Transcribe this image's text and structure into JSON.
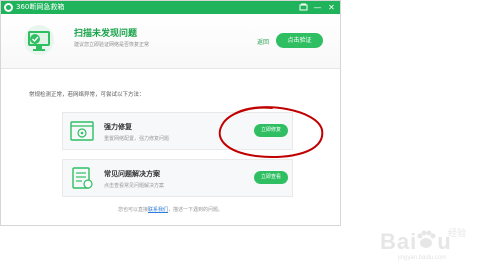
{
  "window": {
    "title": "360断网急救箱",
    "controls": {
      "skin": "skin-icon",
      "minimize": "—",
      "close": "✕"
    }
  },
  "header": {
    "title": "扫描未发现问题",
    "subtitle": "建议您立即验证网络是否恢复正常",
    "return_link": "返回",
    "verify_button": "点击验证"
  },
  "hint": "常规检测正常，若网络异常，可尝试以下方法：",
  "cards": [
    {
      "title": "强力修复",
      "desc": "重置网络配置，强力修复问题",
      "button": "立即修复",
      "icon": "browser-repair-icon"
    },
    {
      "title": "常见问题解决方案",
      "desc": "点击查看常见问题解决方案",
      "button": "立即查看",
      "icon": "document-list-icon"
    }
  ],
  "footer": {
    "prefix": "您也可以直接",
    "link": "联系我们",
    "suffix": "，描述一下遇到的问题。"
  },
  "watermark": {
    "brand": "Bai",
    "brand_end": "u",
    "side_top": "经验",
    "url": "jingyan.baidu.com"
  },
  "colors": {
    "titlebar": "#1fb35b",
    "button": "#2fbf62",
    "header_title": "#1aa34a",
    "link": "#2b7bd6",
    "annotation_circle": "#c00000"
  }
}
